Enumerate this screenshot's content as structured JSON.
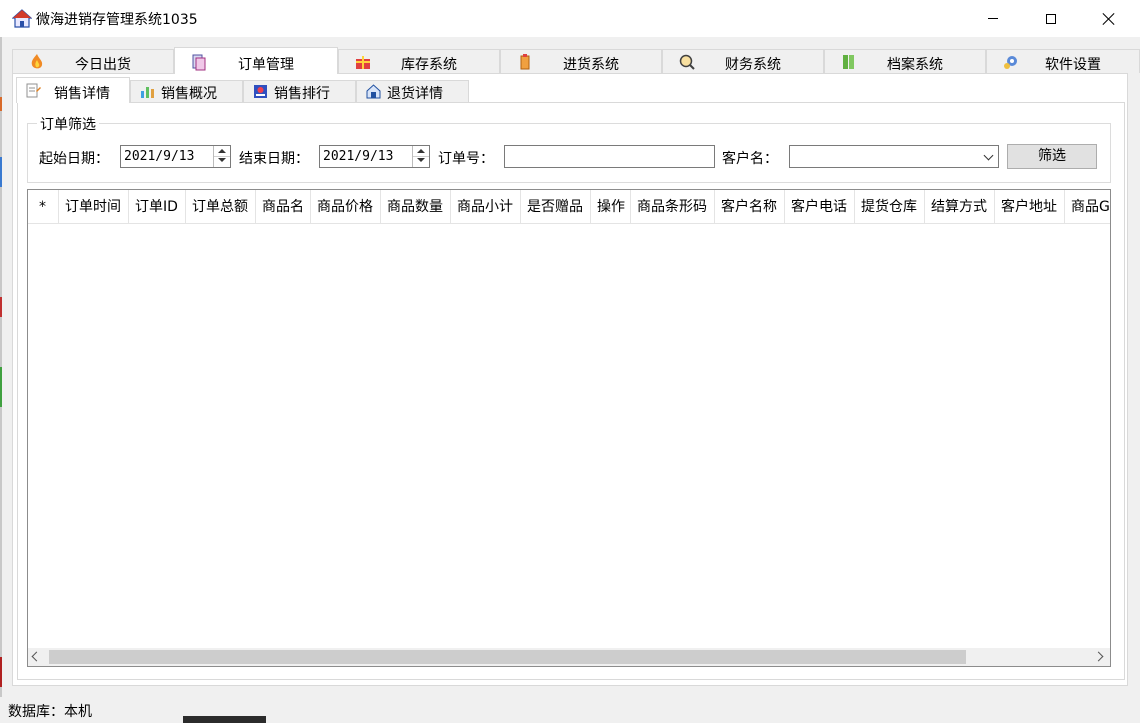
{
  "window": {
    "title": "微海进销存管理系统1035",
    "controls": {
      "minimize": "minimize",
      "maximize": "maximize",
      "close": "close"
    }
  },
  "main_tabs": [
    {
      "label": "今日出货",
      "icon": "fire-icon",
      "active": false
    },
    {
      "label": "订单管理",
      "icon": "document-icon",
      "active": true
    },
    {
      "label": "库存系统",
      "icon": "gift-icon",
      "active": false
    },
    {
      "label": "进货系统",
      "icon": "box-icon",
      "active": false
    },
    {
      "label": "财务系统",
      "icon": "magnifier-icon",
      "active": false
    },
    {
      "label": "档案系统",
      "icon": "books-icon",
      "active": false
    },
    {
      "label": "软件设置",
      "icon": "gear-icon",
      "active": false
    }
  ],
  "sub_tabs": [
    {
      "label": "销售详情",
      "icon": "edit-list-icon",
      "active": true
    },
    {
      "label": "销售概况",
      "icon": "chart-icon",
      "active": false
    },
    {
      "label": "销售排行",
      "icon": "ranking-icon",
      "active": false
    },
    {
      "label": "退货详情",
      "icon": "return-icon",
      "active": false
    }
  ],
  "filter": {
    "group_title": "订单筛选",
    "start_date_label": "起始日期：",
    "start_date_value": "2021/9/13",
    "end_date_label": "结束日期：",
    "end_date_value": "2021/9/13",
    "order_no_label": "订单号：",
    "order_no_value": "",
    "customer_label": "客户名：",
    "customer_value": "",
    "filter_button": "筛选"
  },
  "grid": {
    "columns": [
      "*",
      "订单时间",
      "订单ID",
      "订单总额",
      "商品名",
      "商品价格",
      "商品数量",
      "商品小计",
      "是否赠品",
      "操作",
      "商品条形码",
      "客户名称",
      "客户电话",
      "提货仓库",
      "结算方式",
      "客户地址",
      "商品G"
    ],
    "rows": []
  },
  "status": {
    "text": "数据库：本机"
  },
  "colors": {
    "accent_blue": "#0078d7",
    "window_bg": "#f0f0f0",
    "panel_bg": "#ffffff"
  }
}
